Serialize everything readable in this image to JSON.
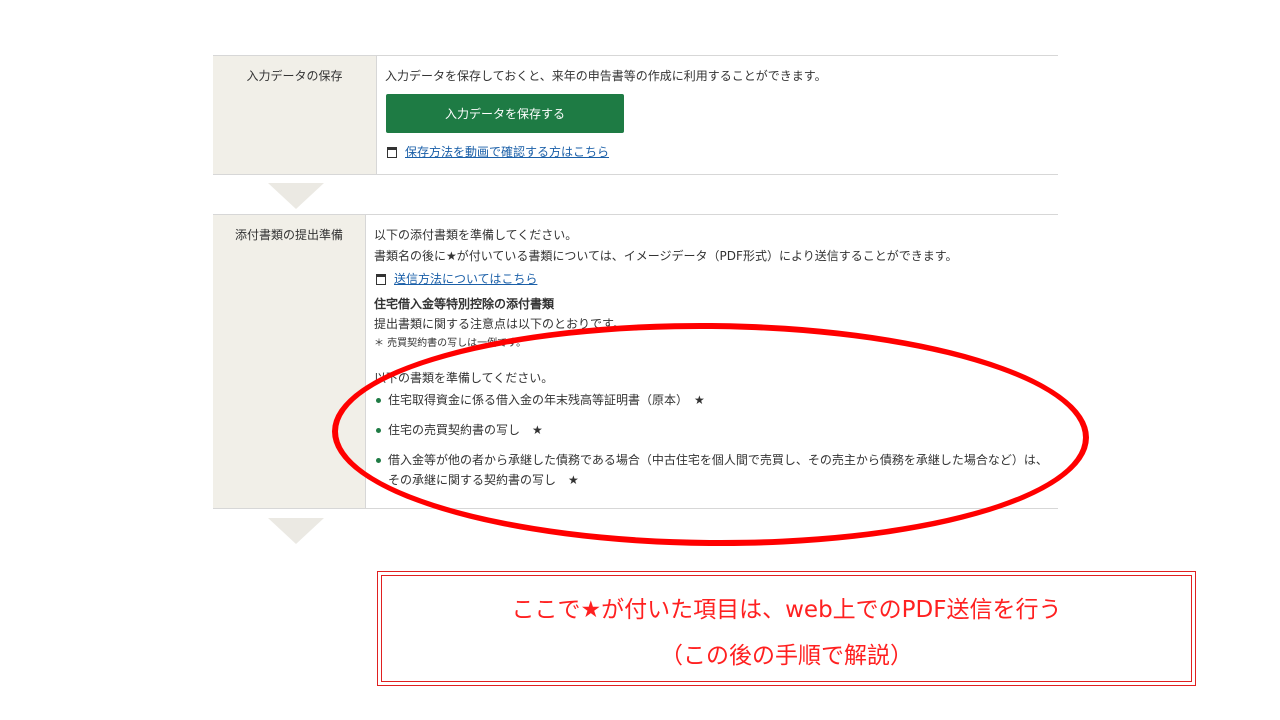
{
  "save_step": {
    "label": "入力データの保存",
    "description": "入力データを保存しておくと、来年の申告書等の作成に利用することができます。",
    "button_label": "入力データを保存する",
    "video_link": "保存方法を動画で確認する方はこちら"
  },
  "attach_step": {
    "label": "添付書類の提出準備",
    "intro": "以下の添付書類を準備してください。",
    "star_note": "書類名の後に★が付いている書類については、イメージデータ（PDF形式）により送信することができます。",
    "send_link": "送信方法についてはこちら",
    "section_heading": "住宅借入金等特別控除の添付書類",
    "notice": "提出書類に関する注意点は以下のとおりです。",
    "footnote": "＊ 売買契約書の写しは一例です。",
    "prepare_text": "以下の書類を準備してください。",
    "items": [
      "住宅取得資金に係る借入金の年末残高等証明書（原本）　★",
      "住宅の売買契約書の写し　★",
      "借入金等が他の者から承継した債務である場合（中古住宅を個人間で売買し、その売主から債務を承継した場合など）は、その承継に関する契約書の写し　★"
    ]
  },
  "callout": {
    "line1": "ここで★が付いた項目は、web上でのPDF送信を行う",
    "line2": "（この後の手順で解説）"
  },
  "colors": {
    "button_green": "#1e7b44",
    "link_blue": "#1a5fa8",
    "annotation_red": "#ff0000",
    "label_bg": "#f1efe8"
  }
}
